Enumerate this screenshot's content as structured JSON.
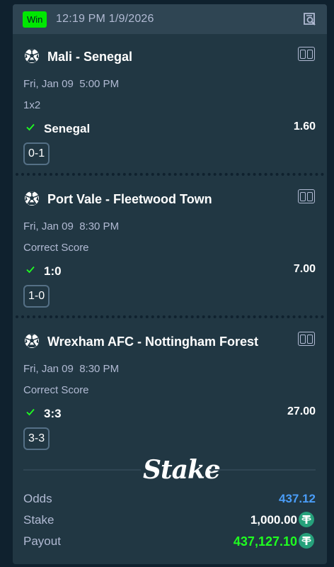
{
  "header": {
    "badge": "Win",
    "datetime": "12:19 PM 1/9/2026",
    "search_icon": "receipt-search-icon"
  },
  "bets": [
    {
      "title": "Mali - Senegal",
      "date": "Fri, Jan 09  5:00 PM",
      "market": "1x2",
      "selection": "Senegal",
      "odds": "1.60",
      "result": "0-1"
    },
    {
      "title": "Port Vale - Fleetwood Town",
      "date": "Fri, Jan 09  8:30 PM",
      "market": "Correct Score",
      "selection": "1:0",
      "odds": "7.00",
      "result": "1-0"
    },
    {
      "title": "Wrexham AFC - Nottingham Forest",
      "date": "Fri, Jan 09  8:30 PM",
      "market": "Correct Score",
      "selection": "3:3",
      "odds": "27.00",
      "result": "3-3"
    }
  ],
  "brand": "Stake",
  "summary": {
    "odds_label": "Odds",
    "odds_value": "437.12",
    "stake_label": "Stake",
    "stake_value": "1,000.00",
    "payout_label": "Payout",
    "payout_value": "437,127.10",
    "currency_icon": "tether-usdt-icon"
  },
  "colors": {
    "background": "#0f212e",
    "card": "#213743",
    "header": "#2f4553",
    "win": "#00e701",
    "odds_accent": "#4a9df8",
    "payout": "#1fff20"
  }
}
